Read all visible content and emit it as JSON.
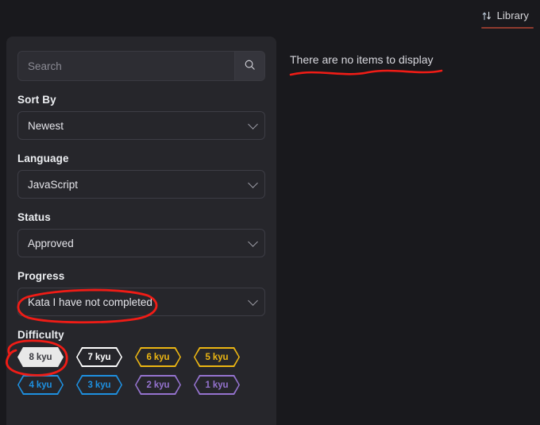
{
  "topbar": {
    "tab_label": "Library",
    "tab_icon": "swap-vertical-icon",
    "active_underline_color": "#8f3b2e"
  },
  "sidebar": {
    "search": {
      "placeholder": "Search",
      "value": "",
      "button_icon": "search-icon"
    },
    "filters": [
      {
        "label": "Sort By",
        "value": "Newest"
      },
      {
        "label": "Language",
        "value": "JavaScript"
      },
      {
        "label": "Status",
        "value": "Approved"
      },
      {
        "label": "Progress",
        "value": "Kata I have not completed"
      }
    ],
    "difficulty": {
      "label": "Difficulty",
      "badges": [
        {
          "label": "8 kyu",
          "color": "#e8e8e8",
          "selected": true
        },
        {
          "label": "7 kyu",
          "color": "#ffffff",
          "selected": false
        },
        {
          "label": "6 kyu",
          "color": "#ecb613",
          "selected": false
        },
        {
          "label": "5 kyu",
          "color": "#ecb613",
          "selected": false
        },
        {
          "label": "4 kyu",
          "color": "#1e90e0",
          "selected": false
        },
        {
          "label": "3 kyu",
          "color": "#1e90e0",
          "selected": false
        },
        {
          "label": "2 kyu",
          "color": "#9573cf",
          "selected": false
        },
        {
          "label": "1 kyu",
          "color": "#9573cf",
          "selected": false
        }
      ]
    }
  },
  "main": {
    "empty_message": "There are no items to display"
  },
  "annotations": {
    "color": "#f01c16",
    "items": [
      {
        "name": "underline-empty-message",
        "target": "There are no items to display"
      },
      {
        "name": "circle-progress-value",
        "target": "Kata I have not completed"
      },
      {
        "name": "circle-kyu8-badge",
        "target": "8 kyu"
      }
    ]
  },
  "theme": {
    "page_bg": "#19191d",
    "panel_bg": "#26262b",
    "text": "#e6e6ea",
    "muted_text": "#8a8a93"
  }
}
